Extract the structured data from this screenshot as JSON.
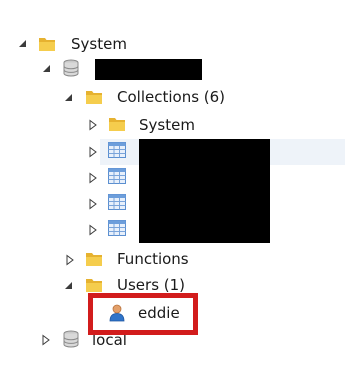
{
  "tree": {
    "root_label": "System",
    "database_label": "",
    "collections_label": "Collections (6)",
    "system_collection_label": "System",
    "functions_label": "Functions",
    "users_label": "Users (1)",
    "user_label": "eddie",
    "local_label": "local"
  },
  "colors": {
    "highlight_box": "#d21c1c",
    "row_highlight": "#eef3f9",
    "redaction": "#000000"
  },
  "icons": {
    "folder": "folder-icon",
    "database": "database-icon",
    "collection": "table-icon",
    "user": "user-icon"
  }
}
